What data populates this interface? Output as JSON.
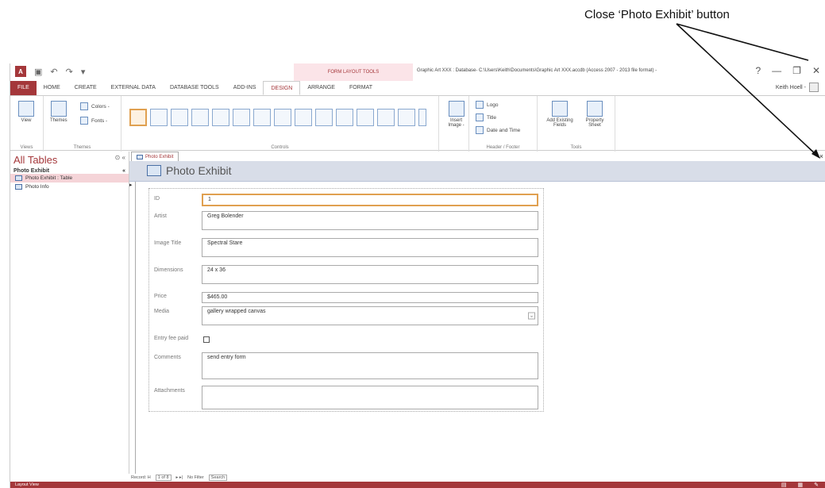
{
  "callout": {
    "text": "Close ‘Photo Exhibit’ button"
  },
  "titlebar": {
    "context_title": "FORM LAYOUT TOOLS",
    "doc_title": "Graphic Art XXX : Database- C:\\Users\\Keith\\Documents\\Graphic Art XXX.accdb (Access 2007 - 2013 file format) -",
    "help": "?",
    "minimize": "—",
    "restore": "❐",
    "close": "✕"
  },
  "tabs": [
    {
      "label": "FILE"
    },
    {
      "label": "HOME"
    },
    {
      "label": "CREATE"
    },
    {
      "label": "EXTERNAL DATA"
    },
    {
      "label": "DATABASE TOOLS"
    },
    {
      "label": "ADD-INS"
    },
    {
      "label": "DESIGN"
    },
    {
      "label": "ARRANGE"
    },
    {
      "label": "FORMAT"
    }
  ],
  "user": {
    "name": "Keith Hoell -"
  },
  "ribbon": {
    "views": {
      "view_label": "View",
      "group_label": "Views"
    },
    "themes": {
      "themes_label": "Themes",
      "colors_label": "Colors -",
      "fonts_label": "Fonts -",
      "group_label": "Themes"
    },
    "controls": {
      "group_label": "Controls"
    },
    "insert_image": {
      "label": "Insert Image -"
    },
    "header_footer": {
      "logo": "Logo",
      "title": "Title",
      "date_time": "Date and Time",
      "group_label": "Header / Footer"
    },
    "tools": {
      "add_fields": "Add Existing Fields",
      "property_sheet": "Property Sheet",
      "group_label": "Tools"
    }
  },
  "nav": {
    "title": "All Tables",
    "group": "Photo Exhibit",
    "items": [
      {
        "label": "Photo Exhibit : Table"
      },
      {
        "label": "Photo Info"
      }
    ]
  },
  "doc_tab": {
    "label": "Photo Exhibit"
  },
  "form": {
    "title": "Photo Exhibit",
    "fields": [
      {
        "label": "ID",
        "value": "1"
      },
      {
        "label": "Artist",
        "value": "Greg Bolender"
      },
      {
        "label": "Image Title",
        "value": "Spectral Stare"
      },
      {
        "label": "Dimensions",
        "value": "24 x 36"
      },
      {
        "label": "Price",
        "value": "$465.00"
      },
      {
        "label": "Media",
        "value": "gallery wrapped canvas"
      },
      {
        "label": "Entry fee paid",
        "value": ""
      },
      {
        "label": "Comments",
        "value": "send entry form"
      },
      {
        "label": "Attachments",
        "value": ""
      }
    ]
  },
  "recnav": {
    "record_label": "Record: H",
    "position": "1 of 8",
    "filter": "No Filter",
    "search": "Search"
  },
  "status": {
    "text": "Layout View"
  },
  "colors": {
    "accent": "#a4373a",
    "header_band": "#d8dde8"
  }
}
